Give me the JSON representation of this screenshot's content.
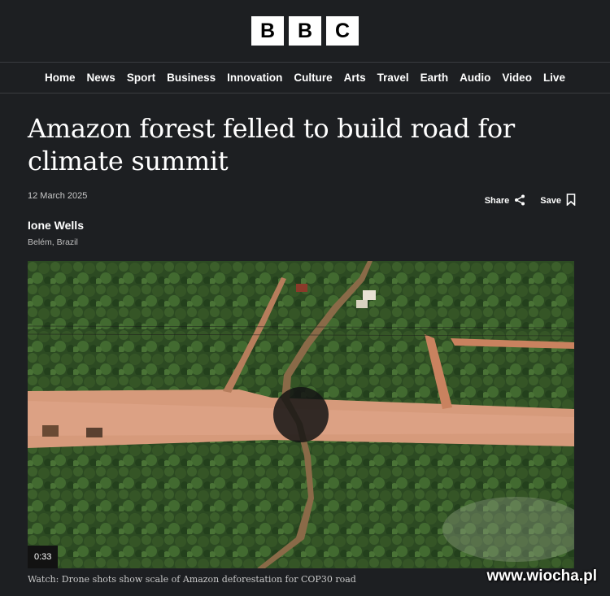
{
  "header": {
    "logo_letters": [
      "B",
      "B",
      "C"
    ]
  },
  "nav": {
    "items": [
      "Home",
      "News",
      "Sport",
      "Business",
      "Innovation",
      "Culture",
      "Arts",
      "Travel",
      "Earth",
      "Audio",
      "Video",
      "Live"
    ]
  },
  "article": {
    "headline": "Amazon forest felled to build road for climate summit",
    "date": "12 March 2025",
    "share_label": "Share",
    "save_label": "Save",
    "author": "Ione Wells",
    "location": "Belém, Brazil"
  },
  "video": {
    "duration": "0:33",
    "caption": "Watch: Drone shots show scale of Amazon deforestation for COP30 road"
  },
  "watermark": "www.wiocha.pl",
  "colors": {
    "background": "#1d1f22",
    "forest": "#2f4a24",
    "road": "#d99a7c"
  }
}
